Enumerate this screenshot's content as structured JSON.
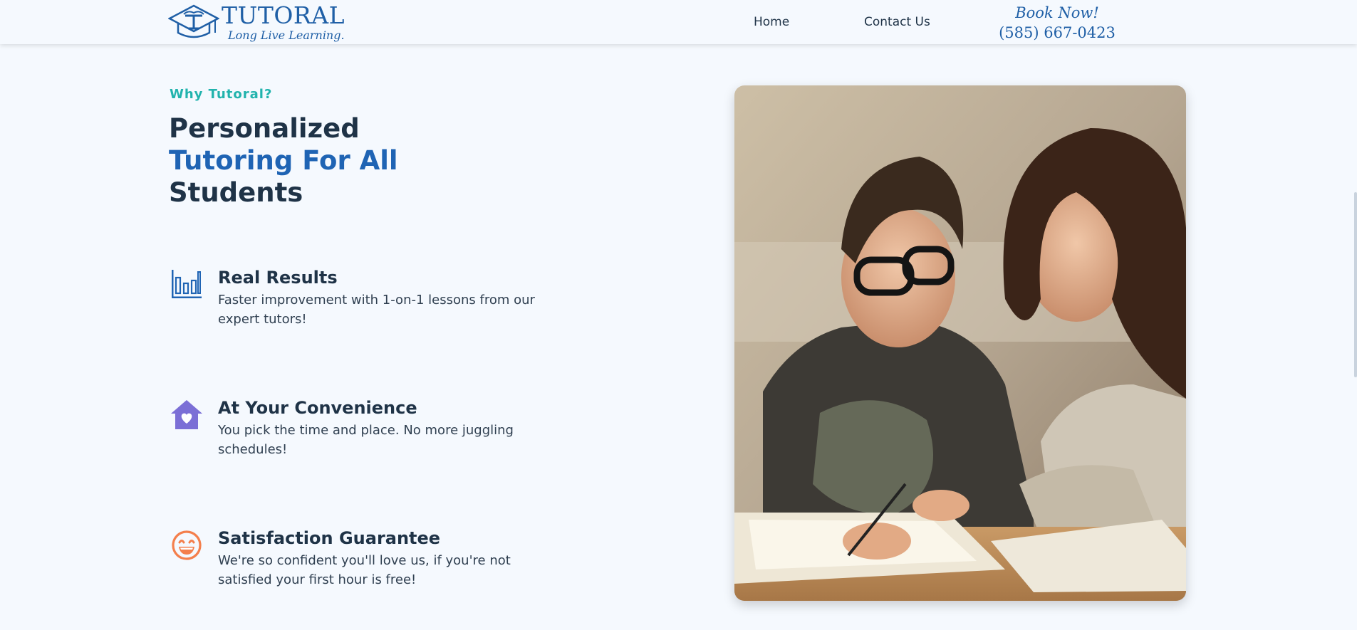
{
  "header": {
    "logo_title": "TUTORAL",
    "logo_tagline": "Long Live Learning.",
    "nav": [
      {
        "label": "Home"
      },
      {
        "label": "Contact Us"
      }
    ],
    "book_label": "Book Now!",
    "phone": "(585) 667-0423"
  },
  "main": {
    "eyebrow": "Why Tutoral?",
    "headline": {
      "line1": "Personalized",
      "line2": "Tutoring For All",
      "line3": "Students"
    },
    "features": [
      {
        "icon": "bar-chart-icon",
        "title": "Real Results",
        "text": "Faster improvement with 1-on-1 lessons from our expert tutors!"
      },
      {
        "icon": "house-heart-icon",
        "title": "At Your Convenience",
        "text": "You pick the time and place. No more juggling schedules!"
      },
      {
        "icon": "smiley-face-icon",
        "title": "Satisfaction Guarantee",
        "text": "We're so confident you'll love us, if you're not satisfied your first hour is free!"
      }
    ],
    "photo_alt": "tutor-and-student-photo"
  },
  "colors": {
    "brand_blue": "#1f64b4",
    "teal": "#21b3ad",
    "purple": "#7b6fd6",
    "orange": "#f47f4c",
    "text_dark": "#1f3347",
    "background": "#f5f9fe"
  }
}
